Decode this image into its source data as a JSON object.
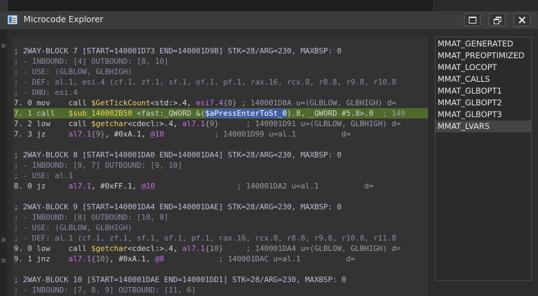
{
  "window": {
    "title": "Microcode Explorer",
    "icon": "microcode-window-icon"
  },
  "maturity_list": {
    "items": [
      "MMAT_GENERATED",
      "MMAT_PREOPTIMIZED",
      "MMAT_LOCOPT",
      "MMAT_CALLS",
      "MMAT_GLBOPT1",
      "MMAT_GLBOPT2",
      "MMAT_GLBOPT3",
      "MMAT_LVARS"
    ],
    "selected": "MMAT_LVARS"
  },
  "code": {
    "b7": {
      "header": "; 2WAY-BLOCK 7 [START=140001D73 END=140001D9B] STK=28/ARG=230, MAXBSP: 0",
      "inbound": "; - INBOUND: [4] OUTBOUND: [8, 10]",
      "use": "; - USE: (GLBLOW, GLBHIGH)",
      "def": "; - DEF: al.1, esi.4 (cf.1, zf.1, sf.1, of.1, pf.1, rax.16, rcx.8, r8.8, r9.8, r10.8",
      "dnu": "; - DNU: esi.4",
      "l0_pre": "7. 0 mov    call ",
      "l0_fn": "$GetTickCount",
      "l0_mid": "<std:>.4, ",
      "l0_var": "esi7.4",
      "l0_tag": "{8}",
      "l0_cmt": " ; 140001D8A u=(GLBLOW, GLBHIGH) d=",
      "l1_pre": "7. 1 call   ",
      "l1_fn": "$sub_140002B50",
      "l1_mid": " <fast:_QWORD &(",
      "l1_sel": "$aPressEnterToSt_0",
      "l1_post": ").8, _QWORD #5.8>.0",
      "l1_cmt": "  ; 140",
      "l2_pre": "7. 2 low    call ",
      "l2_fn": "$getchar",
      "l2_mid": "<cdecl:>.4, ",
      "l2_var": "al7.1",
      "l2_tag": "{9}",
      "l2_cmt": "      ; 140001D91 u=(GLBLOW, GLBHIGH) d=",
      "l3_pre": "7. 3 jz     ",
      "l3_var": "al7.1",
      "l3_tag": "{9}",
      "l3_mid": ", #0xA.1, ",
      "l3_lbl": "@10",
      "l3_cmt": "           ; 140001D99 u=al.1          d="
    },
    "b8": {
      "header": "; 2WAY-BLOCK 8 [START=140001DA0 END=140001DA4] STK=28/ARG=230, MAXBSP: 0",
      "inbound": "; - INBOUND: [9, 7] OUTBOUND: [9, 10]",
      "use": "; - USE: al.1",
      "l0_pre": "8. 0 jz     ",
      "l0_var": "al7.1",
      "l0_mid": ", #0xFF.1, ",
      "l0_lbl": "@10",
      "l0_cmt": "                  ; 140001DA2 u=al.1          d="
    },
    "b9": {
      "header": "; 2WAY-BLOCK 9 [START=140001DA4 END=140001DAE] STK=28/ARG=230, MAXBSP: 0",
      "inbound": "; - INBOUND: [8] OUTBOUND: [10, 8]",
      "use": "; - USE: (GLBLOW, GLBHIGH)",
      "def": "; - DEF: al.1 (cf.1, zf.1, sf.1, of.1, pf.1, rax.16, rcx.8, r8.8, r9.8, r10.8, r11.8",
      "l0_pre": "9. 0 low    call ",
      "l0_fn": "$getchar",
      "l0_mid": "<cdecl:>.4, ",
      "l0_var": "al7.1",
      "l0_tag": "{10}",
      "l0_cmt": "     ; 140001DA4 u=(GLBLOW, GLBHIGH) d=",
      "l1_pre": "9. 1 jnz    ",
      "l1_var": "al7.1",
      "l1_tag": "{10}",
      "l1_mid": ", #0xA.1, ",
      "l1_lbl": "@8",
      "l1_cmt": "            ; 140001DAC u=al.1          d="
    },
    "b10": {
      "header": "; 2WAY-BLOCK 10 [START=140001DAE END=140001DD1] STK=28/ARG=230, MAXBSP: 0",
      "inbound": "; - INBOUND: [7, 8, 9] OUTBOUND: [11, 6]"
    }
  }
}
